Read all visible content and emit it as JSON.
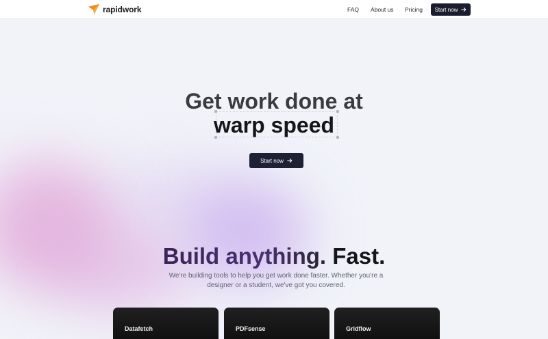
{
  "brand": {
    "name": "rapidwork",
    "accent": "#f28a1e"
  },
  "nav": {
    "links": [
      "FAQ",
      "About us",
      "Pricing"
    ],
    "cta_label": "Start now",
    "cta_icon": "arrow-right-icon"
  },
  "hero": {
    "line1": "Get work done at",
    "line2": "warp speed",
    "cta_label": "Start now",
    "cta_icon": "arrow-right-icon"
  },
  "section": {
    "title_part1": "Build anything.",
    "title_part2": "Fast.",
    "subtitle": "We're building tools to help you get work done faster. Whether you're a designer or a student, we've got you covered."
  },
  "products": [
    {
      "name": "Datafetch"
    },
    {
      "name": "PDFsense"
    },
    {
      "name": "Gridflow"
    }
  ],
  "colors": {
    "background": "#f1f3f9",
    "button": "#1b1c2e",
    "card": "#111111"
  }
}
